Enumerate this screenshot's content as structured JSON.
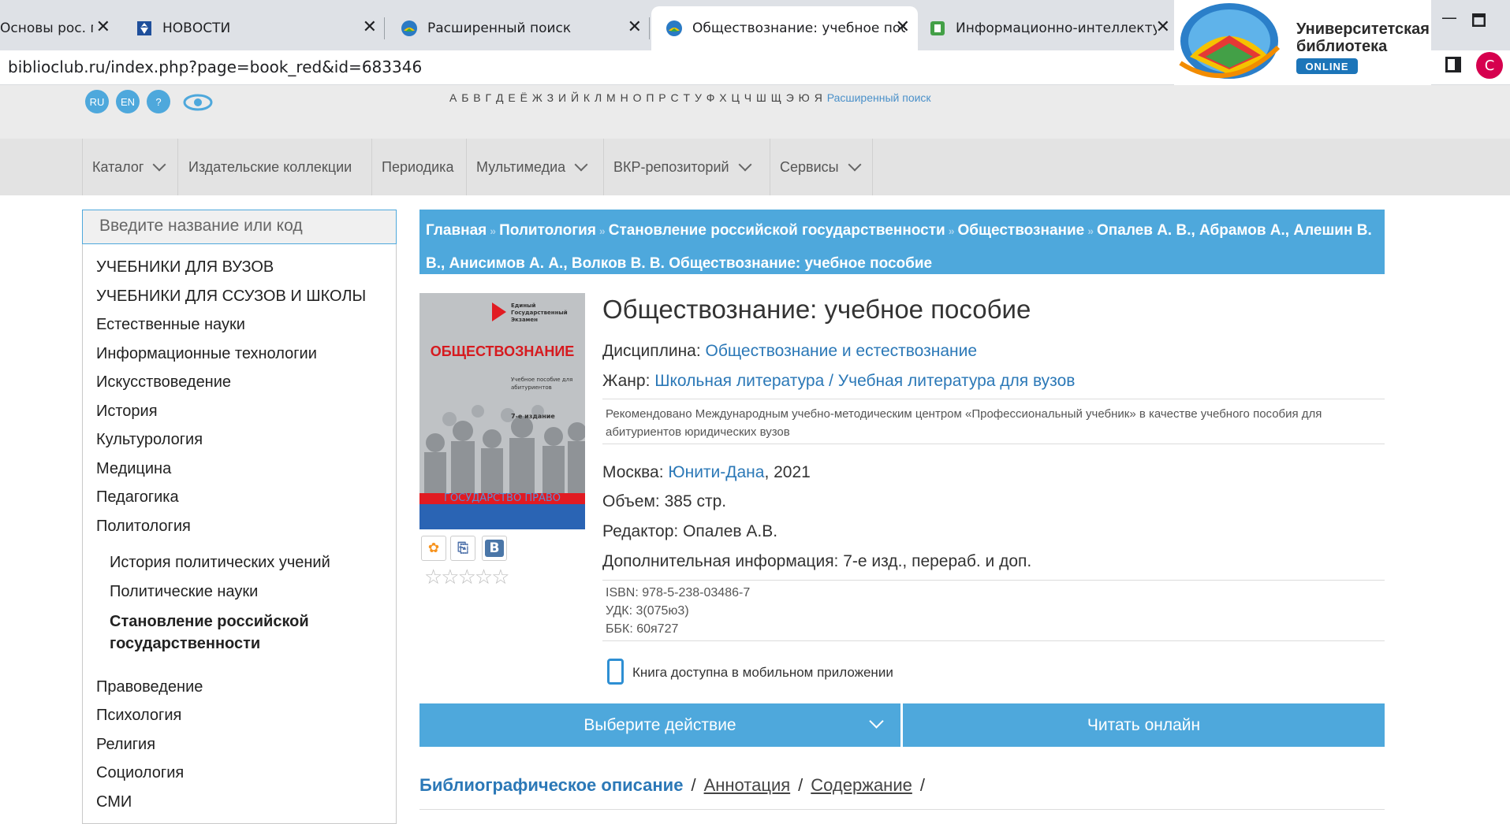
{
  "browser": {
    "tabs": [
      {
        "title": "Основы рос. гос"
      },
      {
        "title": "НОВОСТИ"
      },
      {
        "title": "Расширенный поиск"
      },
      {
        "title": "Обществознание: учебное посо"
      },
      {
        "title": "Информационно-интеллектуал"
      }
    ],
    "url": "biblioclub.ru/index.php?page=book_red&id=683346",
    "profile_initial": "C"
  },
  "logo": {
    "line1": "Университетская",
    "line2": "библиотека",
    "badge": "ONLINE"
  },
  "header": {
    "langs": [
      "RU",
      "EN",
      "?"
    ],
    "alphabet": "А Б В Г Д Е Ё Ж З И Й К Л М Н О П Р С Т У Ф Х Ц Ч Ш Щ Э Ю Я",
    "advanced_search": "Расширенный поиск"
  },
  "nav": [
    "Каталог",
    "Издательские коллекции",
    "Периодика",
    "Мультимедиа",
    "ВКР-репозиторий",
    "Сервисы"
  ],
  "sidebar": {
    "search_placeholder": "Введите название или код",
    "items": [
      "УЧЕБНИКИ ДЛЯ ВУЗОВ",
      "УЧЕБНИКИ ДЛЯ ССУЗОВ И ШКОЛЫ",
      "Естественные науки",
      "Информационные технологии",
      "Искусствоведение",
      "История",
      "Культурология",
      "Медицина",
      "Педагогика",
      "Политология"
    ],
    "subitems": [
      "История политических учений",
      "Политические науки",
      "Становление российской государственности"
    ],
    "items2": [
      "Правоведение",
      "Психология",
      "Религия",
      "Социология",
      "СМИ"
    ]
  },
  "breadcrumb": [
    "Главная",
    "Политология",
    "Становление российской государственности",
    "Обществознание",
    "Опалев А. В., Абрамов А., Алешин В. В., Анисимов А. А., Волков В. В. Обществознание: учебное пособие"
  ],
  "book": {
    "cover_title": "ОБЩЕСТВОЗНАНИЕ",
    "cover_header": "Единый Государственный Экзамен",
    "cover_sub": "Учебное пособие для абитуриентов",
    "cover_edition": "7-е издание",
    "cover_bottom": "ГОСУДАРСТВО ПРАВО",
    "title": "Обществознание: учебное пособие",
    "discipline_label": "Дисциплина:",
    "discipline": "Обществознание и естествознание",
    "genre_label": "Жанр:",
    "genre1": "Школьная литература",
    "genre_sep": "/",
    "genre2": "Учебная литература для вузов",
    "note": "Рекомендовано Международным учебно-методическим центром «Профессиональный учебник» в качестве учебного пособия для абитуриентов юридических вузов",
    "city": "Москва:",
    "publisher": "Юнити-Дана",
    "year": ", 2021",
    "volume": "Объем: 385 стр.",
    "editor": "Редактор: Опалев А.В.",
    "extra": "Дополнительная информация: 7-е изд., перераб. и доп.",
    "isbn": "ISBN: 978-5-238-03486-7",
    "udk": "УДК: 3(075ю3)",
    "bbk": "ББК: 60я727",
    "mobile": "Книга доступна в мобильном приложении",
    "rating_stars": 0
  },
  "actions": {
    "choose": "Выберите действие",
    "read": "Читать онлайн"
  },
  "bottom_tabs": {
    "bib": "Библиографическое описание",
    "annot": "Аннотация",
    "contents": "Содержание",
    "sep": "/"
  },
  "colors": {
    "accent": "#4ea8dc",
    "link": "#2b78b7",
    "profile": "#d6004e"
  }
}
